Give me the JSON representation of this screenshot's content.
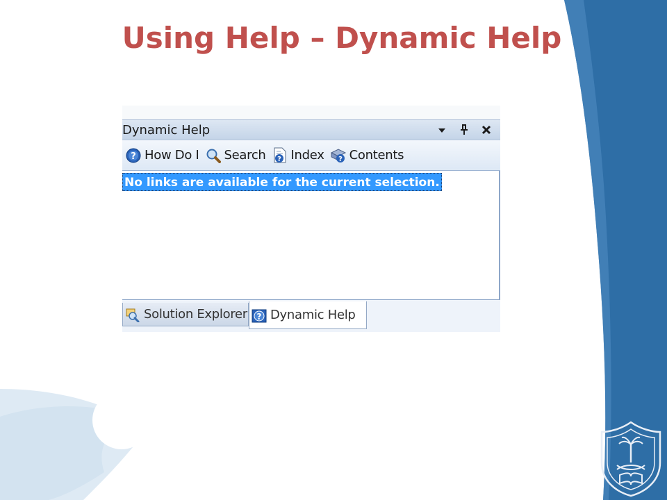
{
  "slide": {
    "title": "Using Help – Dynamic Help"
  },
  "window": {
    "title": "Dynamic Help",
    "controls": {
      "dropdown_icon": "chevron-down-icon",
      "pin_icon": "pin-icon",
      "close_icon": "close-icon"
    }
  },
  "toolbar": {
    "buttons": [
      {
        "label": "How Do I",
        "icon": "help-icon"
      },
      {
        "label": "Search",
        "icon": "search-icon"
      },
      {
        "label": "Index",
        "icon": "index-icon"
      },
      {
        "label": "Contents",
        "icon": "contents-icon"
      }
    ]
  },
  "content": {
    "message": "No links are available for the current selection."
  },
  "tabs": [
    {
      "label": "Solution Explorer",
      "icon": "solution-explorer-icon",
      "active": false
    },
    {
      "label": "Dynamic Help",
      "icon": "help-icon",
      "active": true
    }
  ],
  "colors": {
    "title": "#c0504d",
    "selection": "#3399ff",
    "ribbon_blue": "#2e6ea6"
  }
}
